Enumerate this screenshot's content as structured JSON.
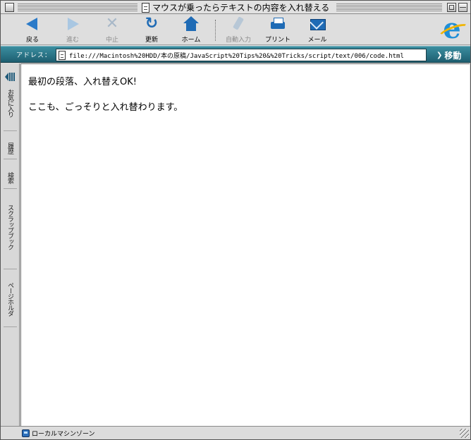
{
  "window": {
    "title": "マウスが乗ったらテキストの内容を入れ替える"
  },
  "toolbar": {
    "back": "戻る",
    "forward": "進む",
    "stop": "中止",
    "refresh": "更新",
    "home": "ホーム",
    "autofill": "自動入力",
    "print": "プリント",
    "mail": "メール",
    "disabled": [
      "forward",
      "stop",
      "autofill"
    ]
  },
  "address": {
    "label": "アドレス：",
    "url": "file:///Macintosh%20HDD/本の原稿/JavaScript%20Tips%20&%20Tricks/script/text/006/code.html",
    "go": "移動"
  },
  "sidebar": {
    "tabs": [
      "お気に入り",
      "履歴",
      "検索",
      "スクラップブック",
      "ページホルダ"
    ]
  },
  "content": {
    "paragraph1": "最初の段落、入れ替えOK!",
    "paragraph2": "ここも、ごっそりと入れ替わります。"
  },
  "status": {
    "zone": "ローカルマシンゾーン"
  },
  "colors": {
    "accent": "#1f6bb5",
    "address_bar": "#2b7487"
  }
}
